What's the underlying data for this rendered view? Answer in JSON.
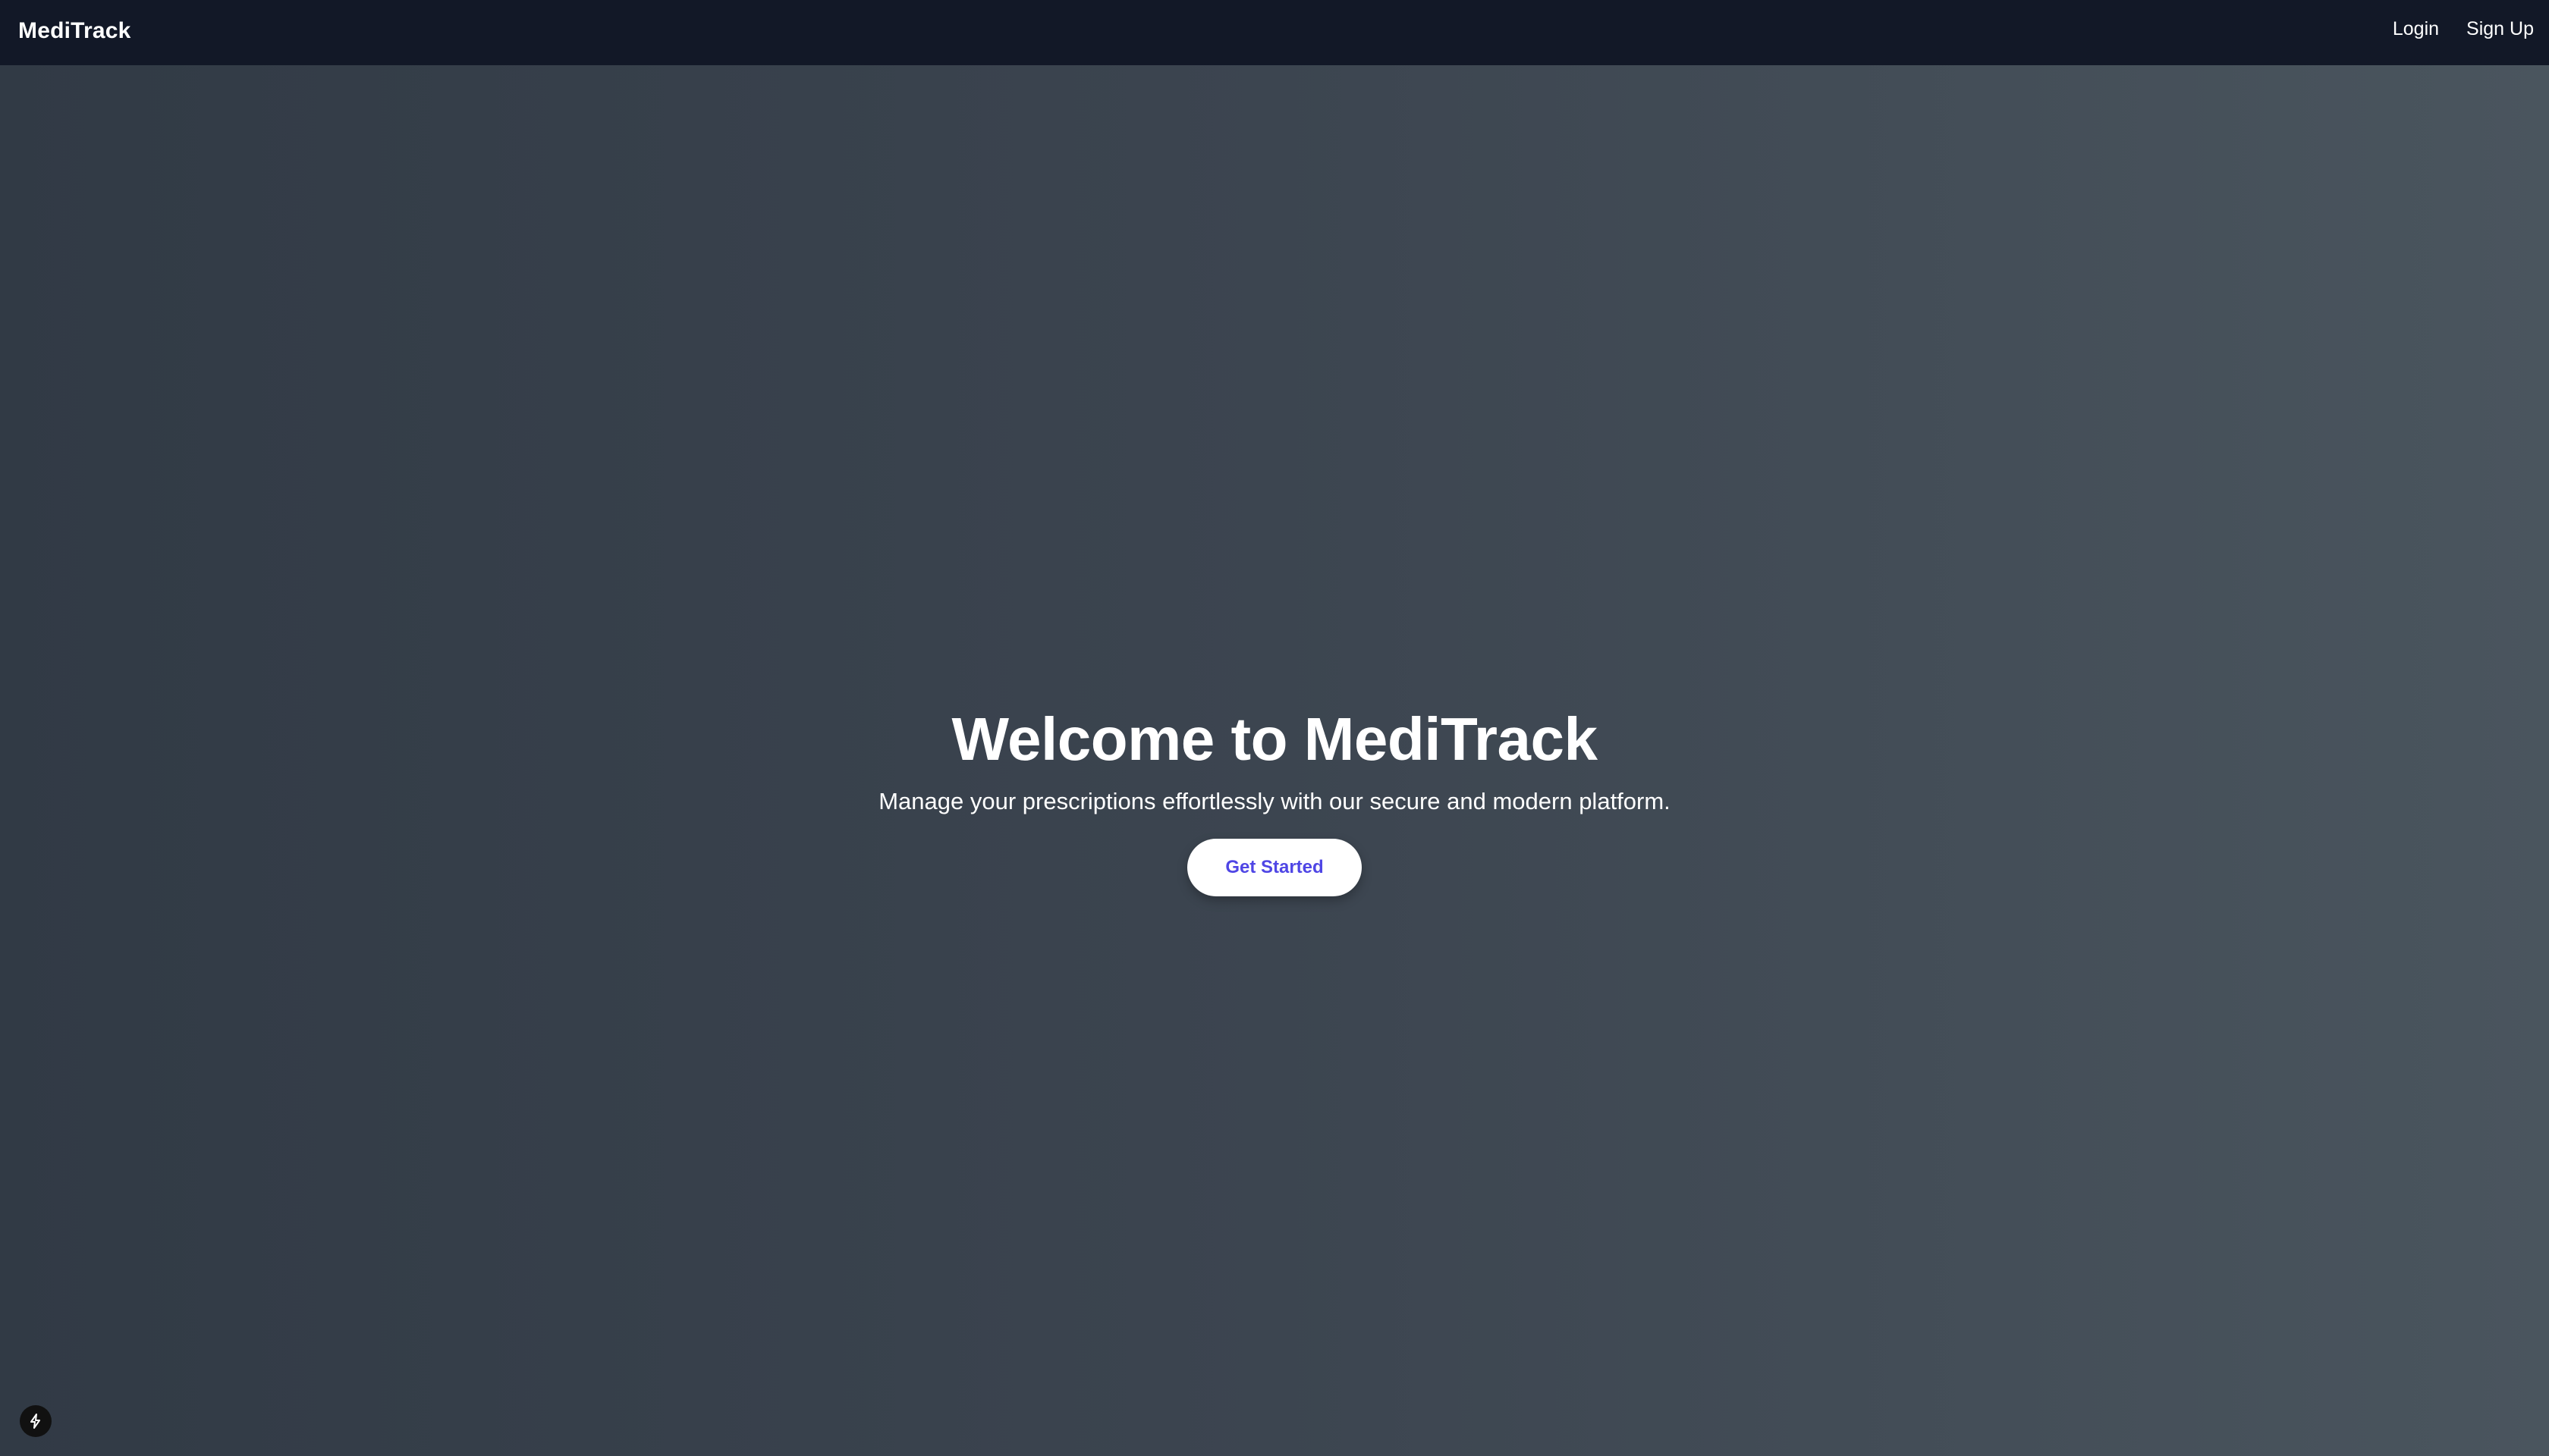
{
  "navbar": {
    "brand": "MediTrack",
    "links": [
      {
        "label": "Login"
      },
      {
        "label": "Sign Up"
      }
    ]
  },
  "hero": {
    "title": "Welcome to MediTrack",
    "subtitle": "Manage your prescriptions effortlessly with our secure and modern platform.",
    "cta_label": "Get Started"
  },
  "corner_badge": {
    "icon": "lightning-bolt-icon"
  },
  "colors": {
    "navbar_bg": "#121827",
    "background_start": "#313a45",
    "background_end": "#4a555e",
    "cta_text": "#4f46e5",
    "text": "#ffffff"
  }
}
